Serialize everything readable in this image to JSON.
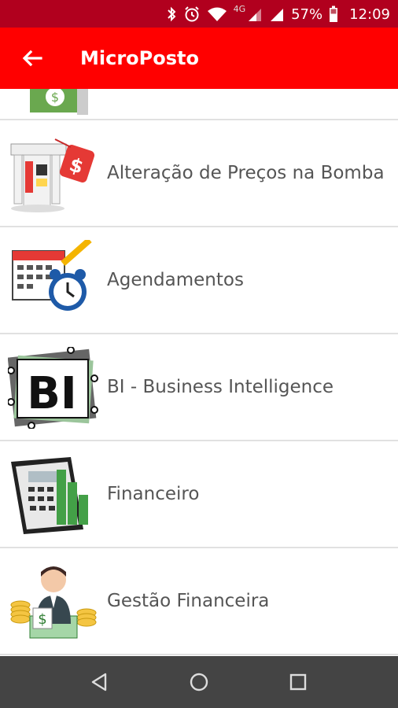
{
  "status": {
    "battery": "57%",
    "time": "12:09",
    "network": "4G"
  },
  "app": {
    "title": "MicroPosto"
  },
  "menu": [
    {
      "label": "Alteração de Preços na Bomba"
    },
    {
      "label": "Agendamentos"
    },
    {
      "label": "BI - Business Intelligence"
    },
    {
      "label": "Financeiro"
    },
    {
      "label": "Gestão Financeira"
    }
  ],
  "colors": {
    "statusbar": "#b1001e",
    "appbar": "#ff0000",
    "navbar": "#444444"
  }
}
